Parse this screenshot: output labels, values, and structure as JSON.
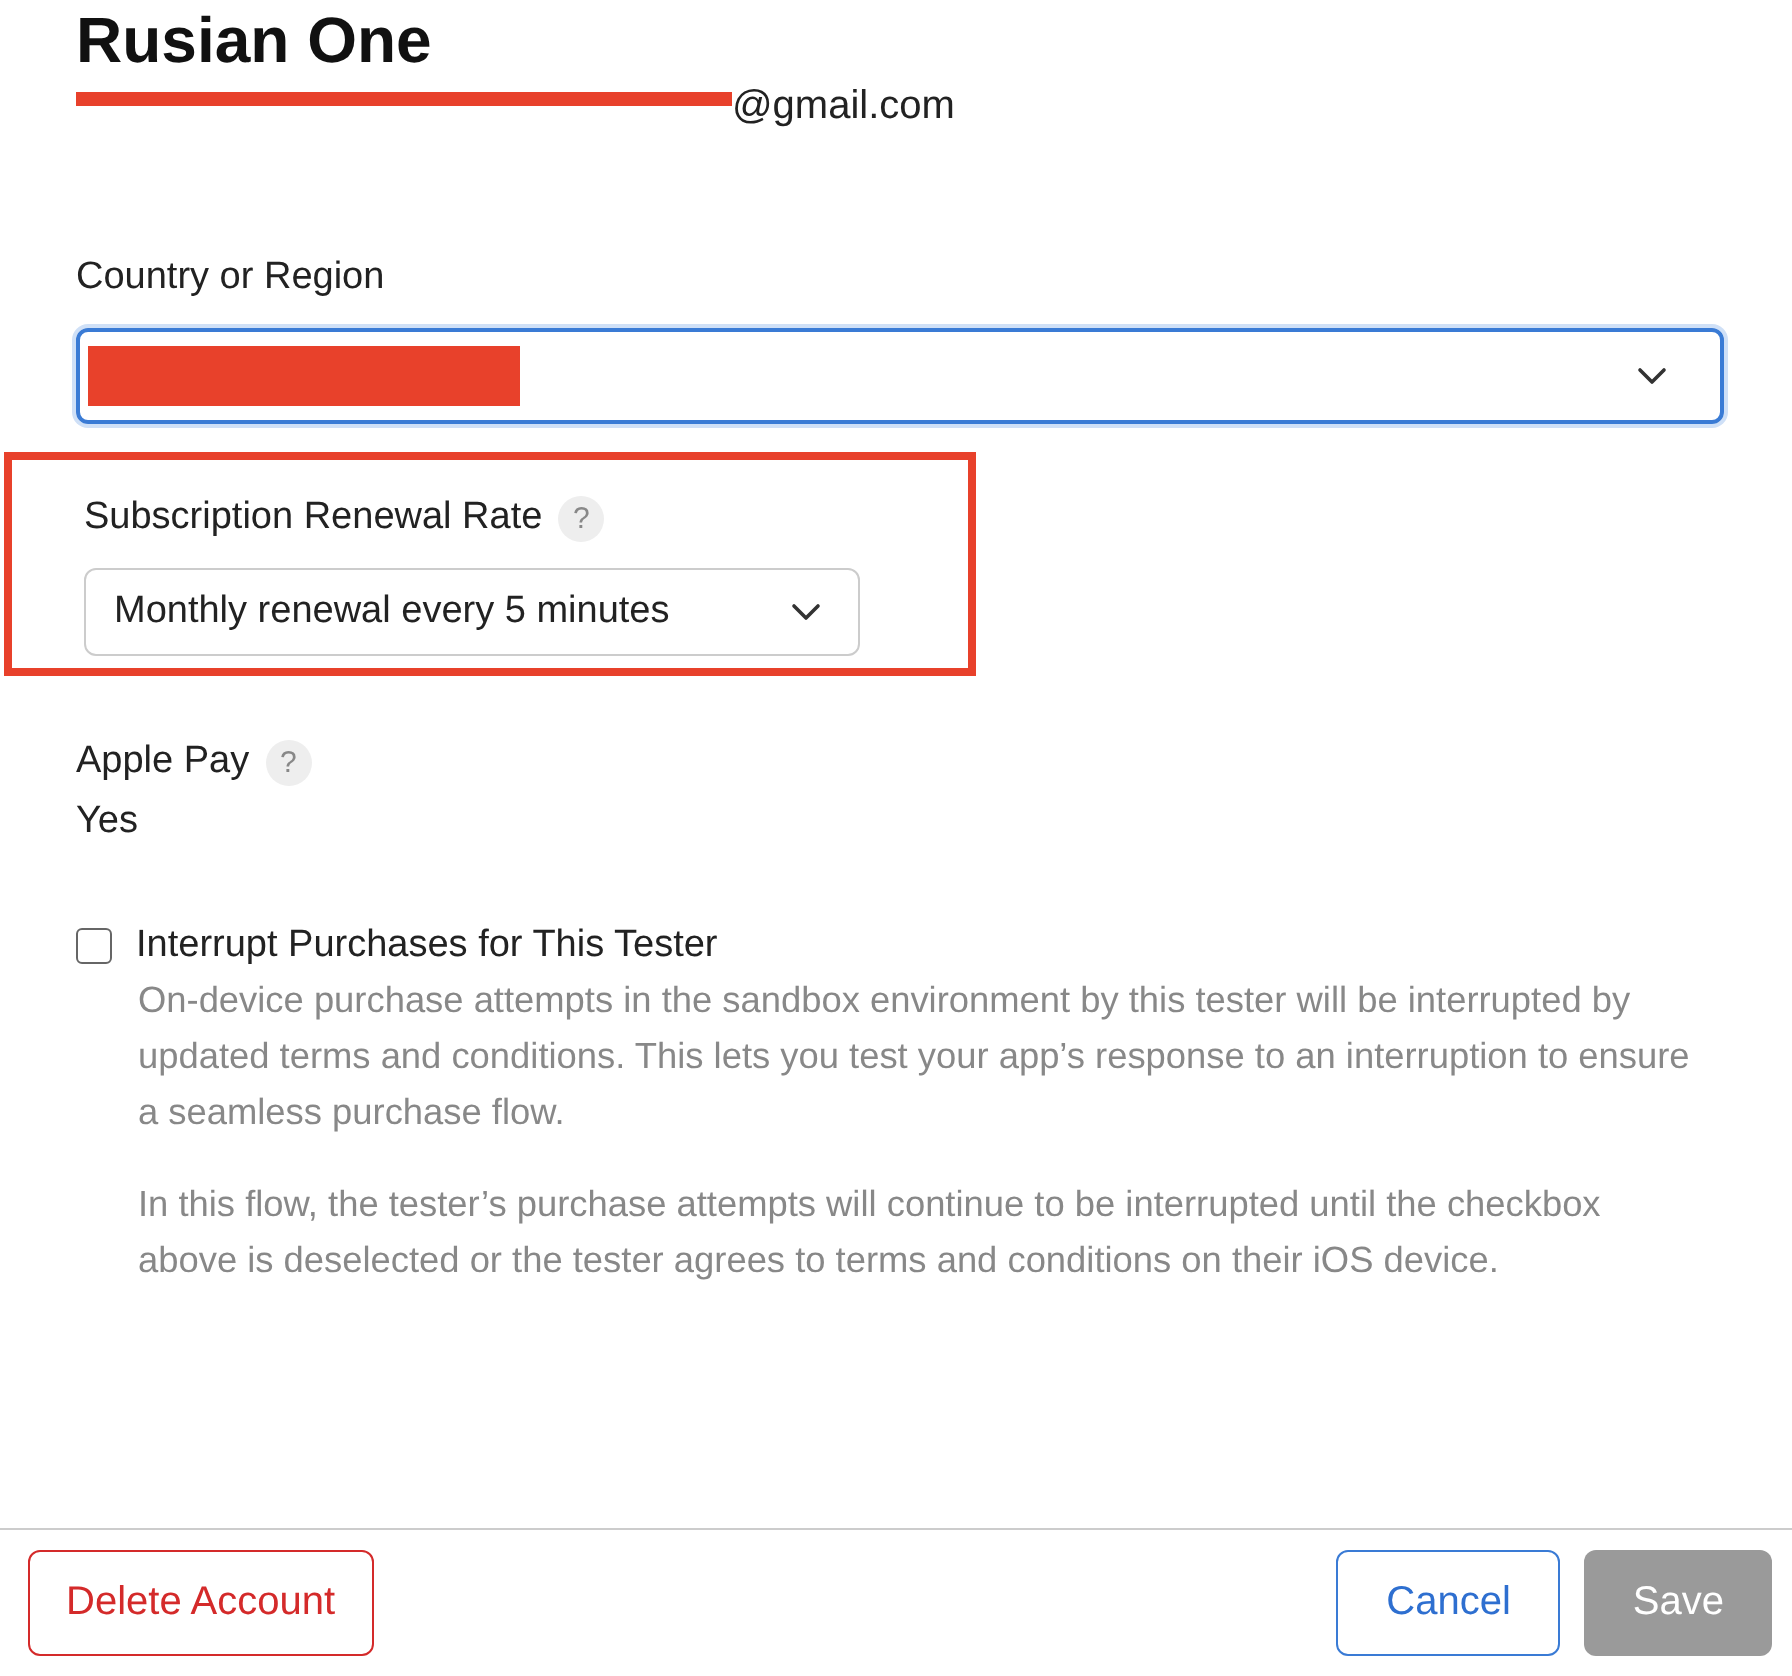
{
  "account": {
    "name": "Rusian One",
    "email_redacted": true,
    "email_domain": "@gmail.com"
  },
  "country": {
    "label": "Country or Region",
    "focused": true,
    "redacted": true
  },
  "renewal": {
    "label": "Subscription Renewal Rate",
    "help": "?",
    "value": "Monthly renewal every 5 minutes",
    "highlighted": true
  },
  "apple_pay": {
    "label": "Apple Pay",
    "help": "?",
    "value": "Yes"
  },
  "interrupt": {
    "label": "Interrupt Purchases for This Tester",
    "checked": false,
    "paragraphs": [
      "On-device purchase attempts in the sandbox environment by this tester will be interrupted by updated terms and conditions. This lets you test your app’s response to an interruption to ensure a seamless purchase flow.",
      "In this flow, the tester’s purchase attempts will continue to be interrupted until the checkbox above is deselected or the tester agrees to terms and conditions on their iOS device."
    ]
  },
  "footer": {
    "buttons": [
      {
        "label": "Delete Account",
        "kind": "destructive",
        "disabled": false
      },
      {
        "label": "Cancel",
        "kind": "secondary",
        "disabled": false
      },
      {
        "label": "Save",
        "kind": "primary",
        "disabled": true
      }
    ]
  }
}
